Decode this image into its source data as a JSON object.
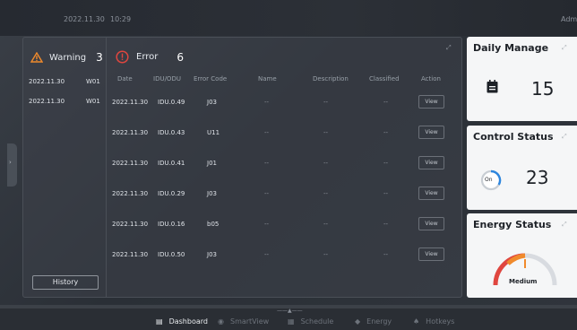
{
  "header": {
    "date": "2022.11.30",
    "time": "10:29",
    "user": "Adm"
  },
  "warning": {
    "label": "Warning",
    "count": "3",
    "rows": [
      {
        "date": "2022.11.30",
        "code": "W01"
      },
      {
        "date": "2022.11.30",
        "code": "W01"
      }
    ],
    "history_label": "History"
  },
  "error": {
    "label": "Error",
    "count": "6",
    "columns": [
      "Date",
      "IDU/ODU",
      "Error Code",
      "Name",
      "Description",
      "Classified",
      "Action"
    ],
    "rows": [
      {
        "date": "2022.11.30",
        "unit": "IDU.0.49",
        "code": "J03",
        "name": "--",
        "description": "--",
        "classified": "--",
        "action": "View"
      },
      {
        "date": "2022.11.30",
        "unit": "IDU.0.43",
        "code": "U11",
        "name": "--",
        "description": "--",
        "classified": "--",
        "action": "View"
      },
      {
        "date": "2022.11.30",
        "unit": "IDU.0.41",
        "code": "J01",
        "name": "--",
        "description": "--",
        "classified": "--",
        "action": "View"
      },
      {
        "date": "2022.11.30",
        "unit": "IDU.0.29",
        "code": "J03",
        "name": "--",
        "description": "--",
        "classified": "--",
        "action": "View"
      },
      {
        "date": "2022.11.30",
        "unit": "IDU.0.16",
        "code": "b05",
        "name": "--",
        "description": "--",
        "classified": "--",
        "action": "View"
      },
      {
        "date": "2022.11.30",
        "unit": "IDU.0.50",
        "code": "J03",
        "name": "--",
        "description": "--",
        "classified": "--",
        "action": "View"
      }
    ]
  },
  "cards": {
    "daily": {
      "title": "Daily Manage",
      "value": "15"
    },
    "control": {
      "title": "Control Status",
      "value": "23",
      "badge": "On"
    },
    "energy": {
      "title": "Energy Status",
      "level": "Medium"
    }
  },
  "nav": [
    {
      "label": "Dashboard",
      "icon": "dashboard-icon",
      "active": true
    },
    {
      "label": "SmartView",
      "icon": "smartview-icon",
      "active": false
    },
    {
      "label": "Schedule",
      "icon": "schedule-icon",
      "active": false
    },
    {
      "label": "Energy",
      "icon": "energy-icon",
      "active": false
    },
    {
      "label": "Hotkeys",
      "icon": "hotkeys-icon",
      "active": false
    }
  ],
  "colors": {
    "warning": "#f08a2c",
    "error": "#e0463f",
    "accent": "#2e86de"
  }
}
